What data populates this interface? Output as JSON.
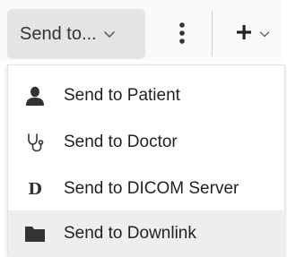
{
  "toolbar": {
    "send_label": "Send to...",
    "send_icon": "chevron-down-icon",
    "more_icon": "more-vertical-icon",
    "add_icon": "plus-icon"
  },
  "menu": {
    "items": [
      {
        "label": "Send to Patient",
        "icon": "person-icon"
      },
      {
        "label": "Send to Doctor",
        "icon": "stethoscope-icon"
      },
      {
        "label": "Send to DICOM Server",
        "icon": "dicom-icon",
        "glyph": "D"
      },
      {
        "label": "Send to Downlink",
        "icon": "folder-icon"
      }
    ],
    "highlighted_index": 3
  },
  "colors": {
    "button_bg": "#e4e4e4",
    "highlight_bg": "#eeeeee",
    "icon": "#333333"
  }
}
